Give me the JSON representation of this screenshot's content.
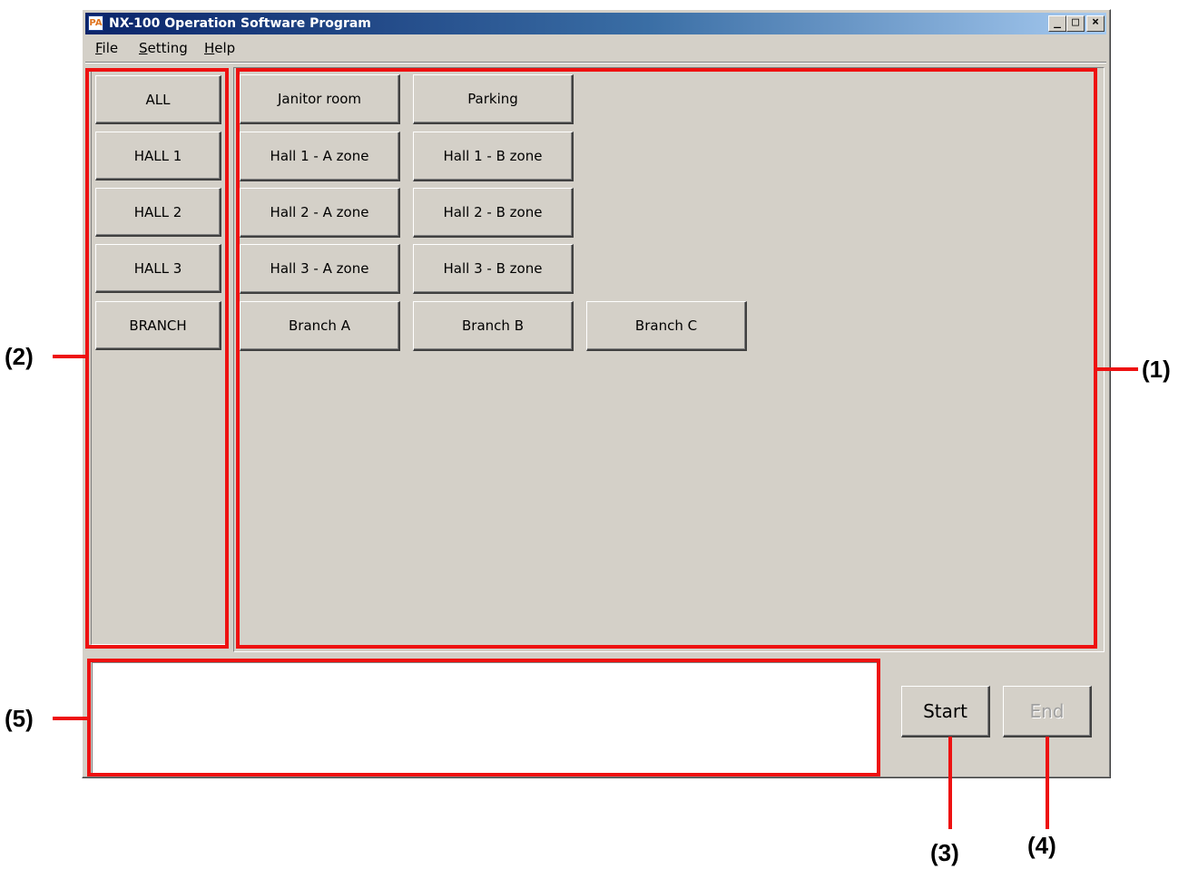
{
  "window": {
    "title": "NX-100 Operation Software Program",
    "icon_label": "PA",
    "controls": {
      "minimize": "_",
      "maximize": "□",
      "close": "×"
    }
  },
  "menu": {
    "items": [
      {
        "first": "F",
        "rest": "ile"
      },
      {
        "first": "S",
        "rest": "etting"
      },
      {
        "first": "H",
        "rest": "elp"
      }
    ]
  },
  "groups": [
    "ALL",
    "HALL 1",
    "HALL 2",
    "HALL 3",
    "BRANCH"
  ],
  "zones": {
    "row1": [
      "Janitor room",
      "Parking"
    ],
    "row2": [
      "Hall 1 - A zone",
      "Hall 1 - B zone"
    ],
    "row3": [
      "Hall 2 - A zone",
      "Hall 2 - B zone"
    ],
    "row4": [
      "Hall 3 - A zone",
      "Hall 3 - B zone"
    ],
    "row5": [
      "Branch A",
      "Branch B",
      "Branch C"
    ]
  },
  "controls": {
    "start_label": "Start",
    "end_label": "End",
    "end_enabled": false
  },
  "status_text": "",
  "callouts": {
    "c1": "(1)",
    "c2": "(2)",
    "c3": "(3)",
    "c4": "(4)",
    "c5": "(5)"
  },
  "colors": {
    "highlight": "#ee1111",
    "window_face": "#d4d0c8",
    "title_start": "#0a246a",
    "title_end": "#a6caf0"
  }
}
